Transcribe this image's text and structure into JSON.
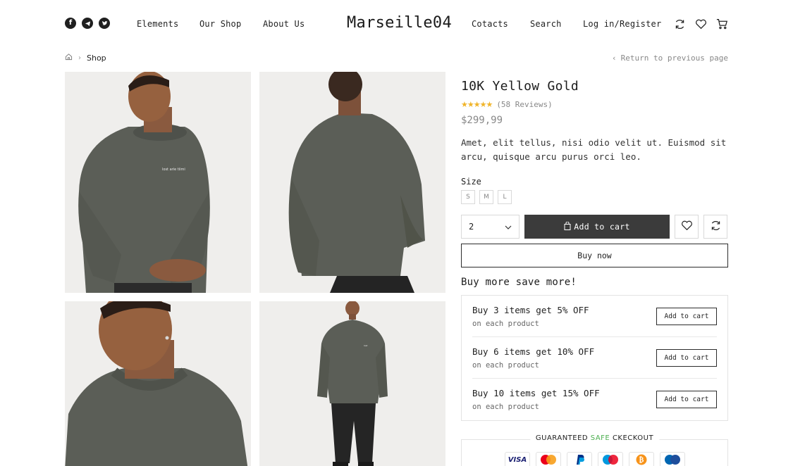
{
  "header": {
    "brand": "Marseille04",
    "social_icons": [
      "facebook-icon",
      "telegram-icon",
      "twitter-icon"
    ],
    "nav_left": [
      "Elements",
      "Our Shop",
      "About Us"
    ],
    "nav_right": [
      "Cotacts",
      "Search",
      "Log in/Register"
    ],
    "action_icons": [
      "compare-icon",
      "heart-icon",
      "cart-icon"
    ]
  },
  "breadcrumb": {
    "home_icon": "home-icon",
    "current": "Shop",
    "return_link": "Return to previous page"
  },
  "product": {
    "title": "10K Yellow Gold",
    "rating_stars": 5,
    "reviews": "(58 Reviews)",
    "price": "$299,99",
    "description": "Amet, elit tellus, nisi odio velit ut. Euismod sit arcu, quisque arcu purus orci leo.",
    "size_label": "Size",
    "sizes": [
      "S",
      "M",
      "L"
    ],
    "quantity": "2",
    "add_to_cart": "Add to cart",
    "buy_now": "Buy now",
    "sweatshirt_print": "lost arie tiimi"
  },
  "bulk": {
    "title": "Buy more save more!",
    "offers": [
      {
        "name": "Buy 3 items get 5% OFF",
        "sub": "on each product",
        "button": "Add to cart"
      },
      {
        "name": "Buy 6 items get 10% OFF",
        "sub": "on each product",
        "button": "Add to cart"
      },
      {
        "name": "Buy 10 items get 15% OFF",
        "sub": "on each product",
        "button": "Add to cart"
      }
    ]
  },
  "checkout": {
    "label_before": "GUARANTEED",
    "label_safe": "SAFE",
    "label_after": "CKECKOUT",
    "visa": "VISA",
    "payment_icons": [
      "visa-icon",
      "mastercard-icon",
      "paypal-icon",
      "maestro-icon",
      "bitcoin-icon",
      "mastercard-blue-icon"
    ]
  },
  "colors": {
    "accent_dark": "#3b3b3b",
    "star": "#f0b429",
    "safe_green": "#4caf50",
    "photo_bg": "#efeeec",
    "sweatshirt": "#5b5e57"
  }
}
